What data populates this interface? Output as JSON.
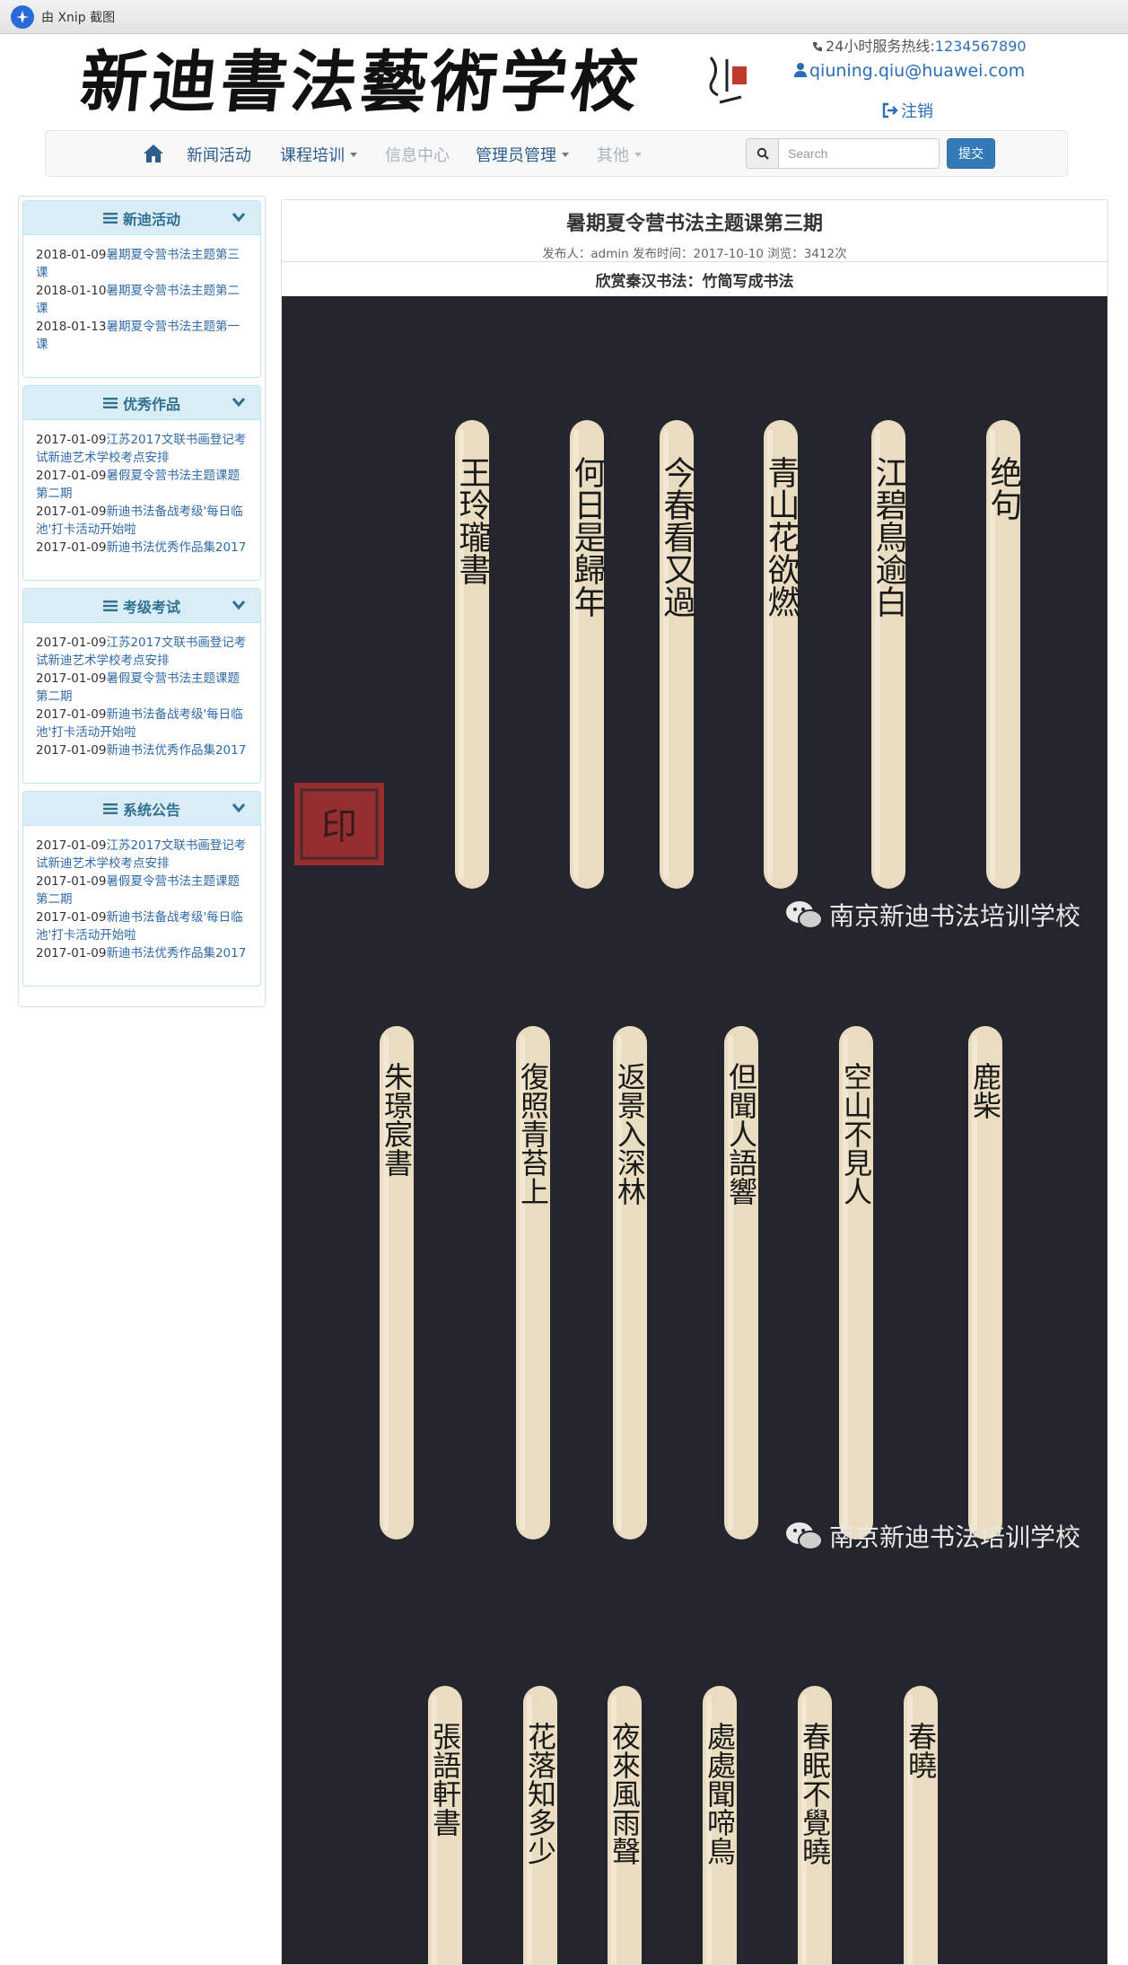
{
  "window": {
    "title": "由 Xnip 截图"
  },
  "header": {
    "logo_text": "新迪書法藝術学校",
    "hotline_label": "24小时服务热线:",
    "hotline_number": "1234567890",
    "email": "qiuning.qiu@huawei.com",
    "logout": "注销"
  },
  "nav": {
    "items": [
      {
        "label": "新闻活动"
      },
      {
        "label": "课程培训"
      },
      {
        "label": "信息中心"
      },
      {
        "label": "管理员管理"
      },
      {
        "label": "其他"
      }
    ],
    "search_placeholder": "Search",
    "submit_label": "提交"
  },
  "sidebar": {
    "panels": [
      {
        "title": "新迪活动",
        "items": [
          {
            "date": "2018-01-09",
            "text": "暑期夏令营书法主题第三课"
          },
          {
            "date": "2018-01-10",
            "text": "暑期夏令营书法主题第二课"
          },
          {
            "date": "2018-01-13",
            "text": "暑期夏令营书法主题第一课"
          }
        ]
      },
      {
        "title": "优秀作品",
        "items": [
          {
            "date": "2017-01-09",
            "text": "江苏2017文联书画登记考试新迪艺术学校考点安排"
          },
          {
            "date": "2017-01-09",
            "text": "暑假夏令营书法主题课题第二期"
          },
          {
            "date": "2017-01-09",
            "text": "新迪书法备战考级'每日临池'打卡活动开始啦"
          },
          {
            "date": "2017-01-09",
            "text": "新迪书法优秀作品集2017"
          }
        ]
      },
      {
        "title": "考级考试",
        "items": [
          {
            "date": "2017-01-09",
            "text": "江苏2017文联书画登记考试新迪艺术学校考点安排"
          },
          {
            "date": "2017-01-09",
            "text": "暑假夏令营书法主题课题第二期"
          },
          {
            "date": "2017-01-09",
            "text": "新迪书法备战考级'每日临池'打卡活动开始啦"
          },
          {
            "date": "2017-01-09",
            "text": "新迪书法优秀作品集2017"
          }
        ]
      },
      {
        "title": "系统公告",
        "items": [
          {
            "date": "2017-01-09",
            "text": "江苏2017文联书画登记考试新迪艺术学校考点安排"
          },
          {
            "date": "2017-01-09",
            "text": "暑假夏令营书法主题课题第二期"
          },
          {
            "date": "2017-01-09",
            "text": "新迪书法备战考级'每日临池'打卡活动开始啦"
          },
          {
            "date": "2017-01-09",
            "text": "新迪书法优秀作品集2017"
          }
        ]
      }
    ]
  },
  "article": {
    "title": "暑期夏令营书法主题课第三期",
    "meta": "发布人：admin 发布时间：2017-10-10 浏览：3412次",
    "subtitle": "欣赏秦汉书法：竹简写成书法",
    "watermark": "南京新迪书法培训学校",
    "photos": [
      {
        "sticks": [
          "王玲瓏書",
          "何日是歸年",
          "今春看又過",
          "青山花欲燃",
          "江碧鳥逾白",
          "绝句"
        ],
        "seal": "印"
      },
      {
        "sticks": [
          "朱璟宸書",
          "復照青苔上",
          "返景入深林",
          "但聞人語響",
          "空山不見人",
          "鹿柴"
        ]
      },
      {
        "sticks": [
          "張語軒書",
          "花落知多少",
          "夜來風雨聲",
          "處處聞啼鳥",
          "春眠不覺曉",
          "春曉"
        ]
      }
    ]
  },
  "colors": {
    "link": "#2f6aa8",
    "panel_heading": "#d9edf7",
    "primary": "#337ab7"
  }
}
